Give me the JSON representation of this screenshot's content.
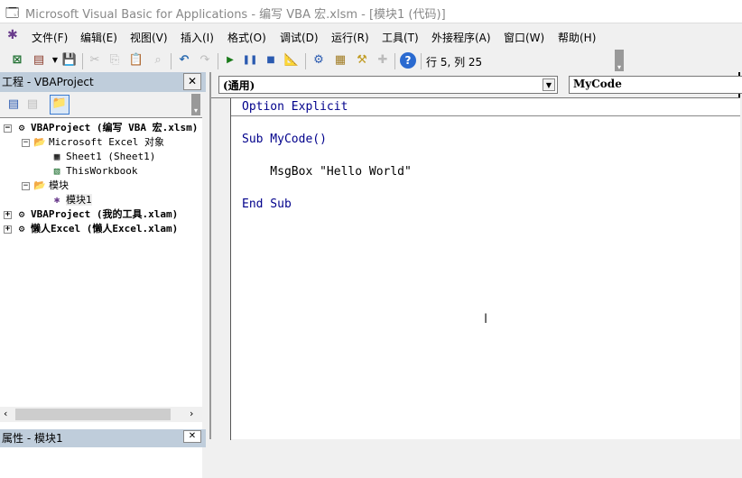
{
  "window": {
    "title": "Microsoft Visual Basic for Applications - 编写 VBA 宏.xlsm - [模块1 (代码)]"
  },
  "menu": [
    "文件(F)",
    "编辑(E)",
    "视图(V)",
    "插入(I)",
    "格式(O)",
    "调试(D)",
    "运行(R)",
    "工具(T)",
    "外接程序(A)",
    "窗口(W)",
    "帮助(H)"
  ],
  "toolbar": {
    "position": "行 5, 列 25"
  },
  "project": {
    "title": "工程 - VBAProject",
    "tree": [
      {
        "label": "VBAProject (编写 VBA 宏.xlsm)",
        "expanded": true
      },
      {
        "label": "Microsoft Excel 对象"
      },
      {
        "label": "Sheet1 (Sheet1)"
      },
      {
        "label": "ThisWorkbook"
      },
      {
        "label": "模块"
      },
      {
        "label": "模块1"
      },
      {
        "label": "VBAProject (我的工具.xlam)"
      },
      {
        "label": "懒人Excel (懒人Excel.xlam)"
      }
    ]
  },
  "properties": {
    "title": "属性 - 模块1"
  },
  "code": {
    "object_combo": "(通用)",
    "proc_combo": "MyCode",
    "lines": {
      "l1a": "Option Explicit",
      "l2a": "Sub",
      "l2b": " MyCode()",
      "l3": "    MsgBox \"Hello World\"",
      "l4a": "End Sub"
    }
  }
}
